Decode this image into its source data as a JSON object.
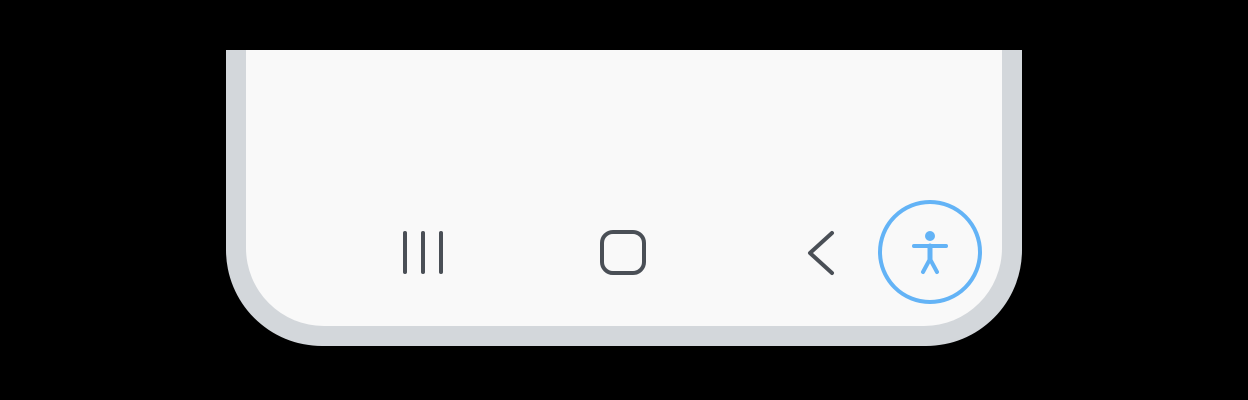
{
  "navigation_bar": {
    "buttons": [
      {
        "id": "recents",
        "icon": "recent-apps-icon"
      },
      {
        "id": "home",
        "icon": "home-icon"
      },
      {
        "id": "back",
        "icon": "back-icon"
      },
      {
        "id": "accessibility",
        "icon": "accessibility-icon"
      }
    ]
  },
  "colors": {
    "frame": "#d3d7db",
    "screen": "#f9f9f9",
    "nav_icon": "#4a4f56",
    "accessibility_accent": "#63b3f6"
  }
}
